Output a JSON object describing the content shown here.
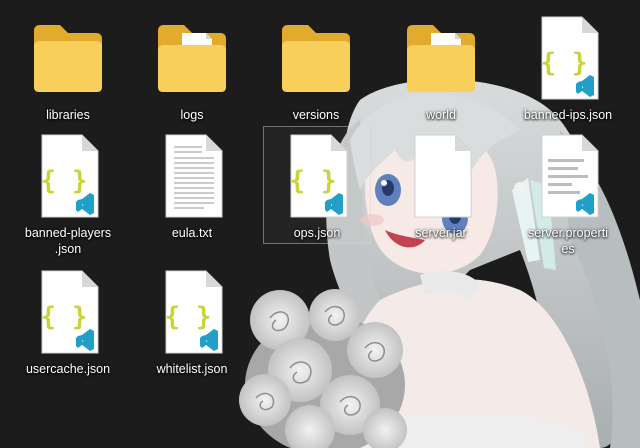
{
  "desktop": {
    "items": [
      {
        "label": "libraries",
        "icon": "folder-icon"
      },
      {
        "label": "logs",
        "icon": "folder-with-files-icon"
      },
      {
        "label": "versions",
        "icon": "folder-icon"
      },
      {
        "label": "world",
        "icon": "folder-with-files-icon"
      },
      {
        "label": "banned-ips.json",
        "icon": "json-file-icon"
      },
      {
        "label": "banned-players\n.json",
        "icon": "json-file-icon"
      },
      {
        "label": "eula.txt",
        "icon": "text-file-icon"
      },
      {
        "label": "ops.json",
        "icon": "json-file-icon",
        "selected": true
      },
      {
        "label": "server.jar",
        "icon": "blank-file-icon"
      },
      {
        "label": "server.properti\nes",
        "icon": "properties-file-icon"
      },
      {
        "label": "usercache.json",
        "icon": "json-file-icon"
      },
      {
        "label": "whitelist.json",
        "icon": "json-file-icon"
      }
    ]
  },
  "colors": {
    "background": "#1c1c1c",
    "folder_front": "#f7cf5a",
    "folder_back": "#e2ab2e",
    "json_braces": "#c9d33a",
    "vscode_badge": "#20a0c8",
    "hair": "#cfd2d4"
  }
}
